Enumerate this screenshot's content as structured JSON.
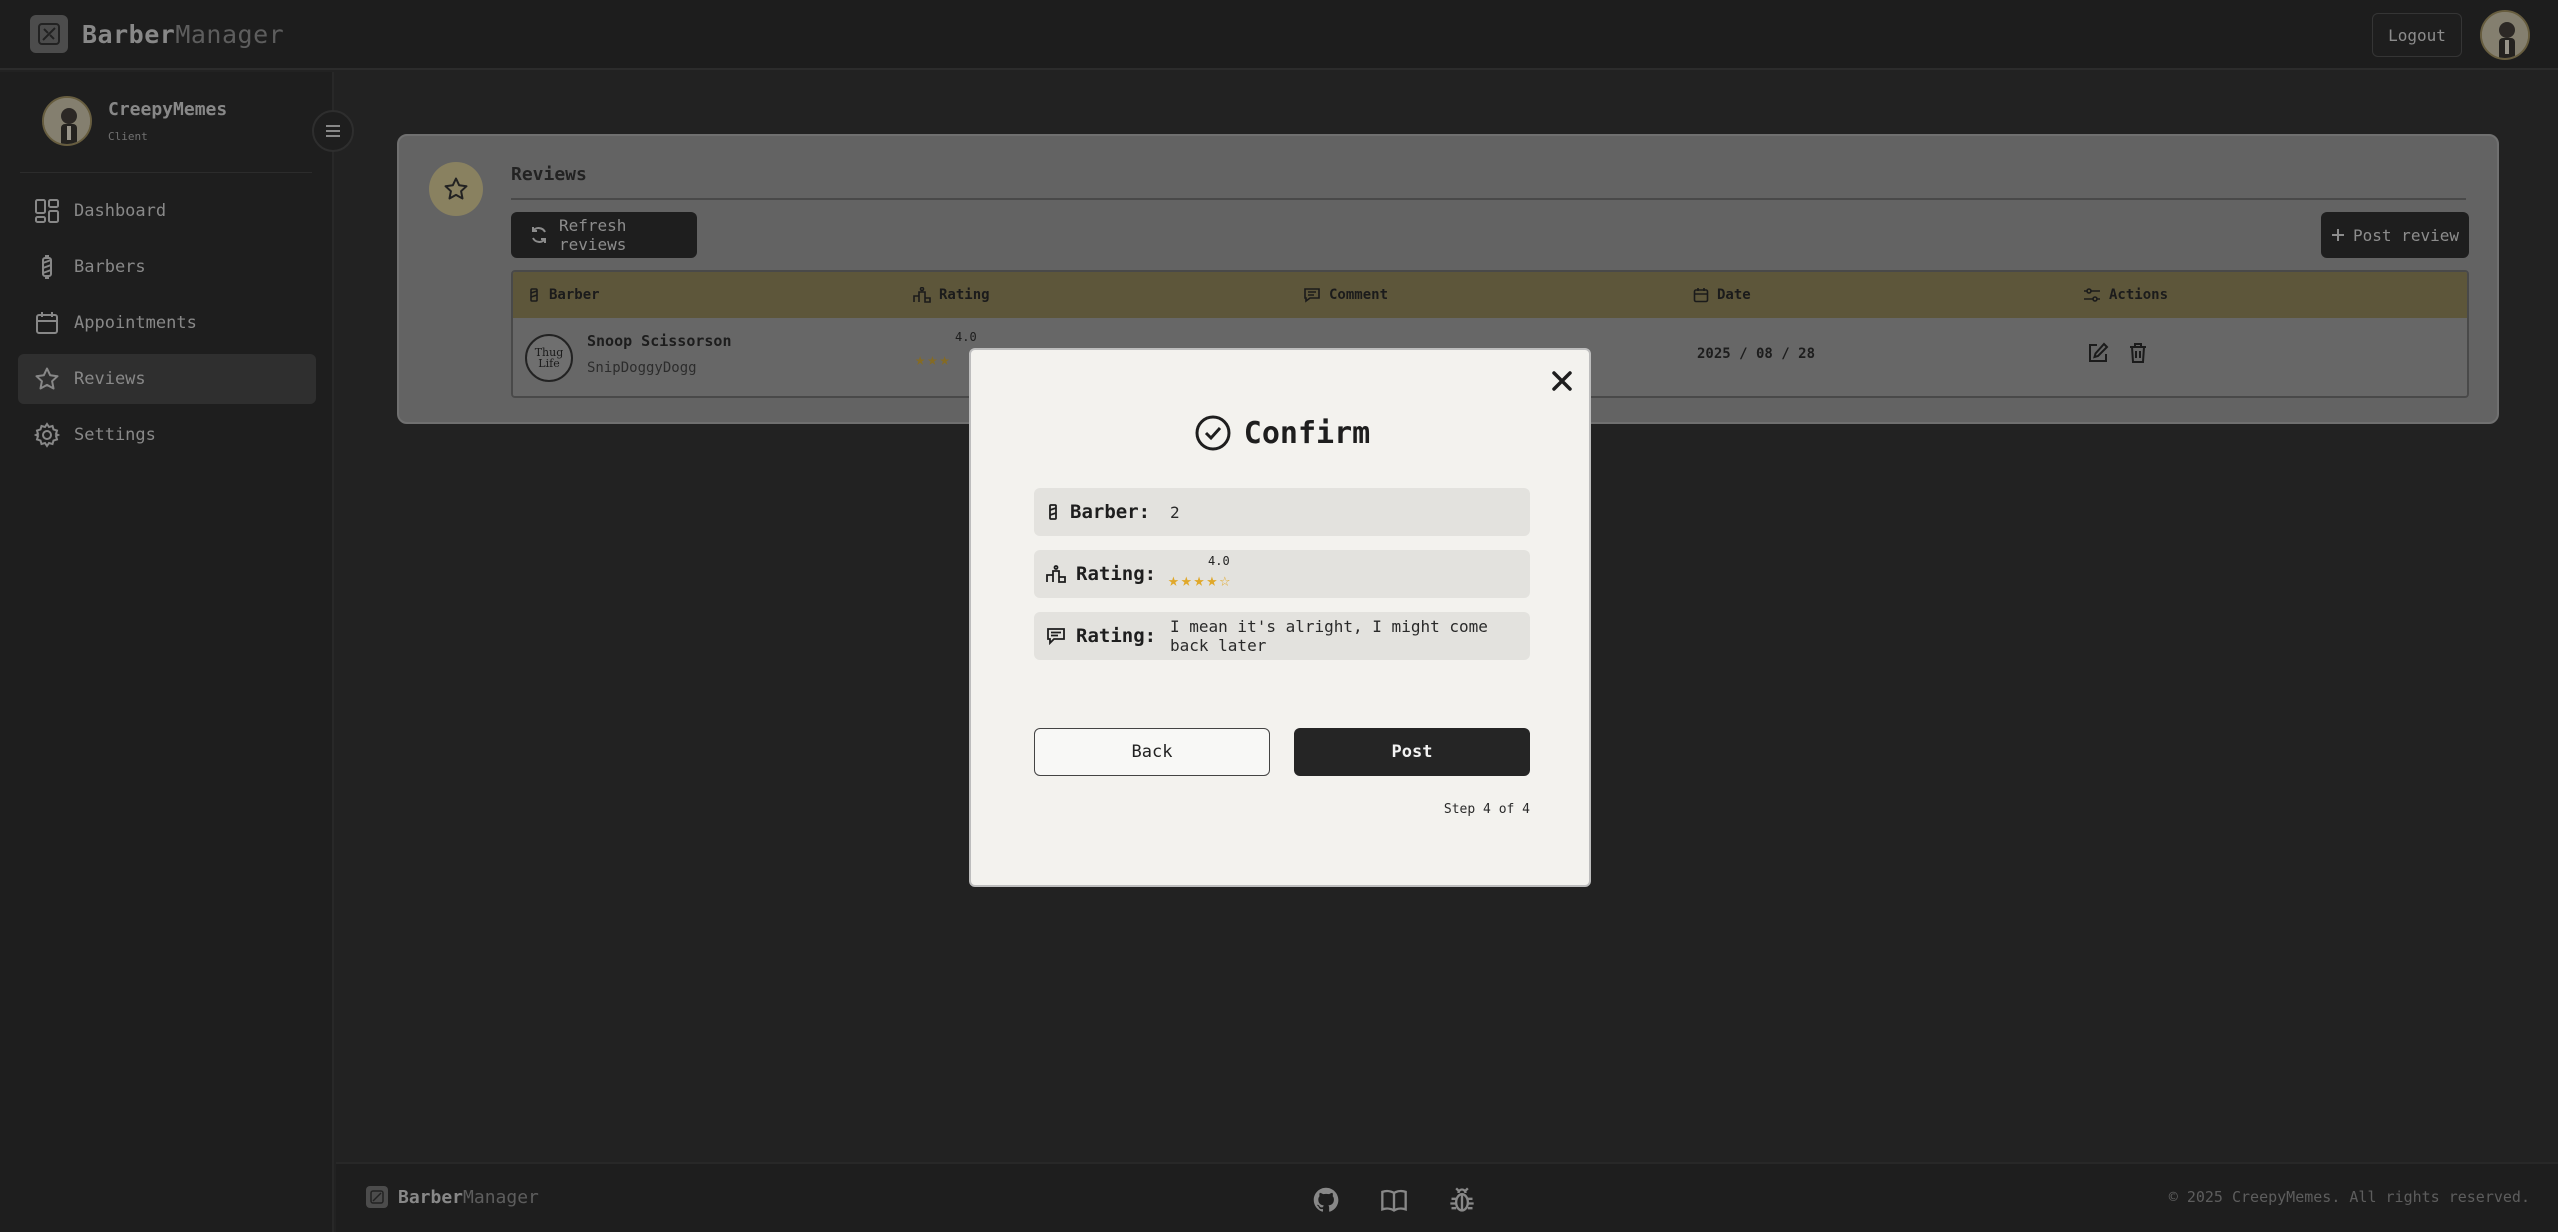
{
  "app": {
    "brand_primary": "Barber",
    "brand_secondary": "Manager"
  },
  "topbar": {
    "logout_label": "Logout"
  },
  "user": {
    "name": "CreepyMemes",
    "role": "Client"
  },
  "sidebar": {
    "items": [
      {
        "label": "Dashboard",
        "icon": "dashboard-icon",
        "active": false
      },
      {
        "label": "Barbers",
        "icon": "barber-pole-icon",
        "active": false
      },
      {
        "label": "Appointments",
        "icon": "calendar-icon",
        "active": false
      },
      {
        "label": "Reviews",
        "icon": "star-icon",
        "active": true
      },
      {
        "label": "Settings",
        "icon": "gear-icon",
        "active": false
      }
    ]
  },
  "reviews": {
    "title": "Reviews",
    "refresh_label": "Refresh reviews",
    "post_label": "Post review",
    "columns": [
      "Barber",
      "Rating",
      "Comment",
      "Date",
      "Actions"
    ],
    "rows": [
      {
        "avatar_text": "Thug Life",
        "barber_name": "Snoop Scissorson",
        "barber_user": "SnipDoggyDogg",
        "rating": "4.0",
        "rating_value": 4,
        "stars": "★★★",
        "date": "2025 / 08 / 28"
      }
    ]
  },
  "modal": {
    "title": "Confirm",
    "barber_label": "Barber:",
    "barber_value": "2",
    "rating_label": "Rating:",
    "rating_value": "4.0",
    "rating_stars": "★★★★☆",
    "comment_label": "Rating:",
    "comment_value": "I mean it's alright, I might come back later",
    "back_label": "Back",
    "post_label": "Post",
    "step_text": "Step 4 of 4"
  },
  "footer": {
    "brand_primary": "Barber",
    "brand_secondary": "Manager",
    "icons": [
      "github-icon",
      "book-icon",
      "bug-icon"
    ],
    "copyright": "© 2025 CreepyMemes. All rights reserved."
  },
  "colors": {
    "accent_gold": "#d0c38e",
    "table_header": "#8a7f52",
    "star": "#e0a82a",
    "dark": "#242424"
  }
}
